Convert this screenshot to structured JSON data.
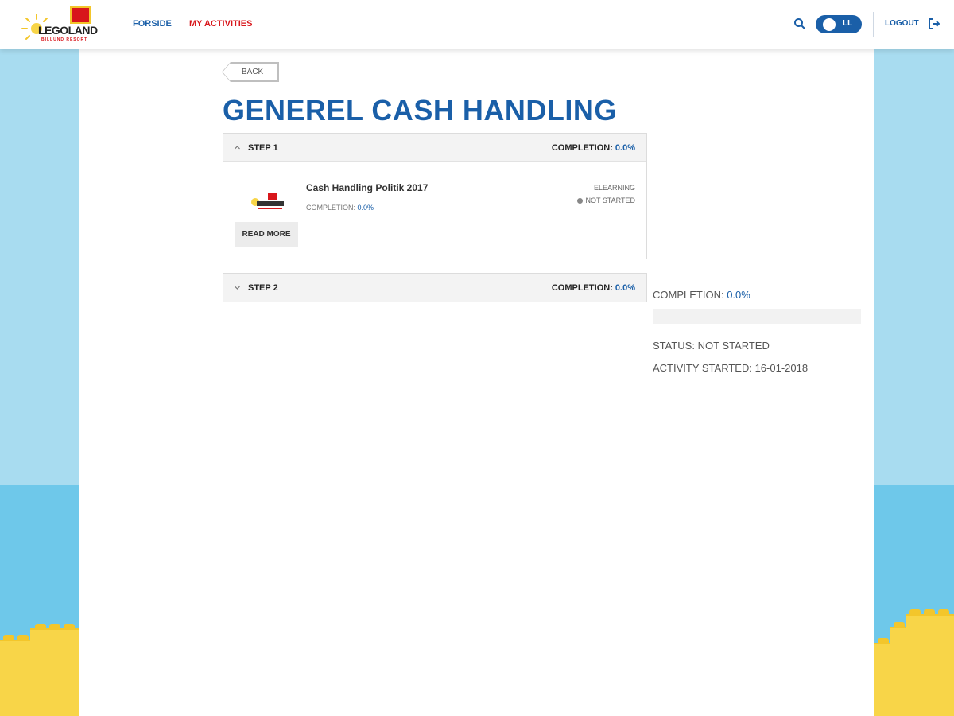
{
  "header": {
    "logo_text": "LEGOLAND",
    "logo_subtext": "BILLUND RESORT",
    "nav": [
      {
        "label": "FORSIDE",
        "active": false
      },
      {
        "label": "MY ACTIVITIES",
        "active": true
      }
    ],
    "user_initials": "LL",
    "logout_label": "LOGOUT",
    "icons": {
      "search": "search-icon",
      "logout": "logout-icon"
    }
  },
  "main": {
    "back_label": "BACK",
    "title": "GENEREL CASH HANDLING",
    "steps": [
      {
        "label": "STEP 1",
        "expanded": true,
        "completion_label": "COMPLETION:",
        "completion_value": "0.0%",
        "activities": [
          {
            "title": "Cash Handling Politik 2017",
            "completion_label": "COMPLETION:",
            "completion_value": "0.0%",
            "type": "ELEARNING",
            "status": "NOT STARTED",
            "read_more_label": "READ MORE"
          }
        ]
      },
      {
        "label": "STEP 2",
        "expanded": false,
        "completion_label": "COMPLETION:",
        "completion_value": "0.0%"
      }
    ]
  },
  "summary": {
    "completion_label": "COMPLETION:",
    "completion_value": "0.0%",
    "progress": 0.0,
    "status_text": "STATUS: NOT STARTED",
    "started_text": "ACTIVITY STARTED: 16-01-2018"
  },
  "colors": {
    "brand_blue": "#1a5fa8",
    "brand_red": "#d8161b",
    "brick_yellow": "#f8d548",
    "sky_light": "#a8dcf0",
    "sky_dark": "#6ec8ea"
  }
}
